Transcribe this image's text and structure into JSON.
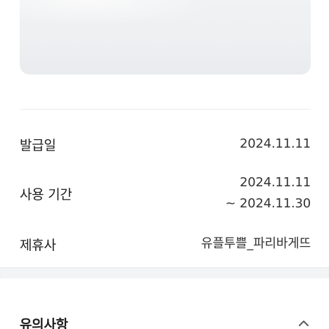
{
  "details": {
    "issue_date": {
      "label": "발급일",
      "value": "2024.11.11"
    },
    "usage_period": {
      "label": "사용 기간",
      "start": "2024.11.11",
      "end": "~ 2024.11.30"
    },
    "partner": {
      "label": "제휴사",
      "value": "유플투쁠_파리바게뜨"
    }
  },
  "notice": {
    "title": "유의사항",
    "expanded": true,
    "toggle_icon": "chevron-up-icon"
  },
  "colors": {
    "text_primary": "#1e1e1e",
    "text_value": "#333333",
    "divider": "#ececec",
    "section_gap": "#f3f4f6",
    "image_bg": "#eef0f2"
  }
}
